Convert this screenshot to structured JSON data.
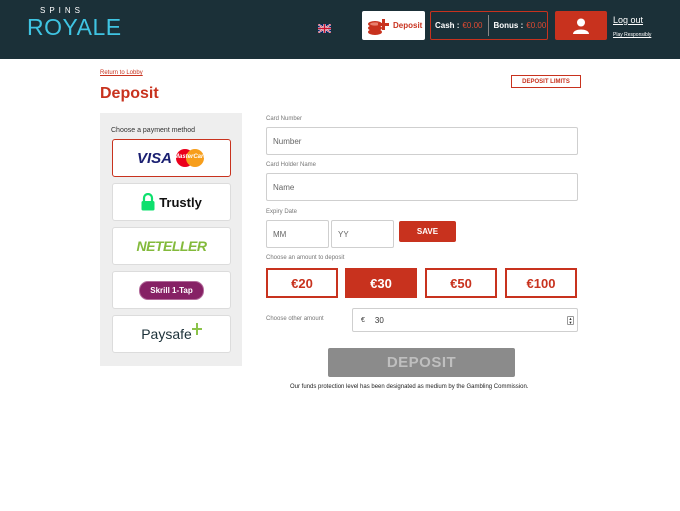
{
  "header": {
    "logo_top": "SPINS",
    "logo_main": "ROYALE",
    "deposit_label": "Deposit",
    "cash_label": "Cash :",
    "cash_value": "€0.00",
    "bonus_label": "Bonus :",
    "bonus_value": "€0.00",
    "logout": "Log out",
    "play_responsibly": "Play Responsibly",
    "icons": [
      "uk-flag-icon",
      "coins-plus-icon",
      "user-icon"
    ]
  },
  "page": {
    "return_link": "Return to Lobby",
    "title": "Deposit",
    "deposit_limits": "DEPOSIT LIMITS"
  },
  "payment": {
    "heading": "Choose a payment method",
    "methods": [
      {
        "name": "Visa / MasterCard",
        "visa_text": "VISA",
        "mc_text": "MasterCard",
        "selected": true
      },
      {
        "name": "Trustly",
        "text": "Trustly"
      },
      {
        "name": "Neteller",
        "text": "NETELLER"
      },
      {
        "name": "Skrill 1-Tap",
        "text": "Skrill 1-Tap"
      },
      {
        "name": "Paysafe",
        "text": "Paysafe"
      }
    ]
  },
  "form": {
    "card_number_label": "Card Number",
    "card_number_placeholder": "Number",
    "holder_label": "Card Holder Name",
    "holder_placeholder": "Name",
    "expiry_label": "Expiry Date",
    "expiry_mm": "MM",
    "expiry_yy": "YY",
    "save_label": "SAVE",
    "amount_label": "Choose an amount to deposit",
    "amounts": [
      "€20",
      "€30",
      "€50",
      "€100"
    ],
    "selected_amount": "€30",
    "other_label": "Choose other amount",
    "currency_symbol": "€",
    "other_value": "30",
    "deposit_button": "DEPOSIT",
    "note": "Our funds protection level has been designated as medium by the Gambling Commission."
  },
  "colors": {
    "header_bg": "#1b3038",
    "accent": "#c8321e",
    "logo": "#3fc4e2",
    "disabled_button": "#8b8b8b"
  }
}
